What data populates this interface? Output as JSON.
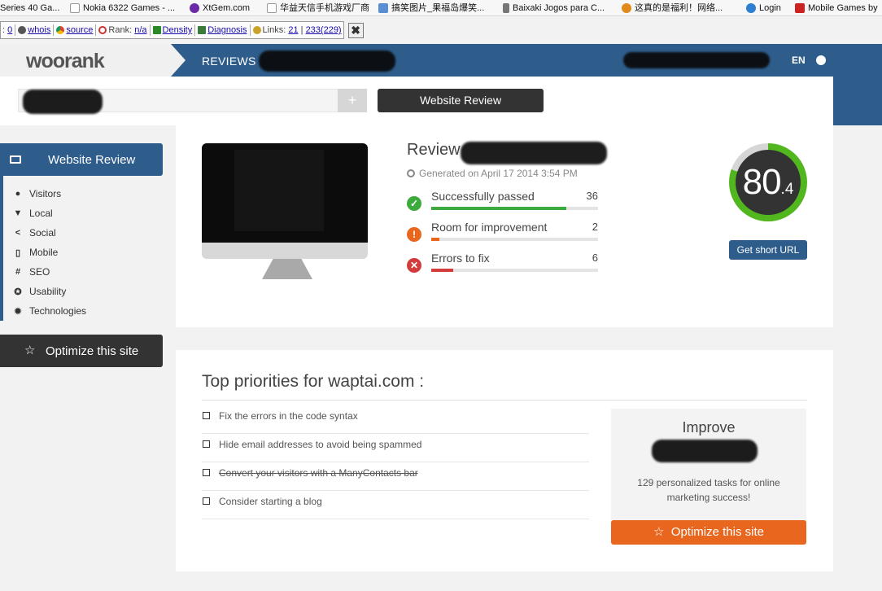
{
  "bookmarks": [
    {
      "label": "Series 40 Ga...",
      "color": "#d9a21b"
    },
    {
      "label": "Nokia 6322 Games - ...",
      "color": "#dddddd"
    },
    {
      "label": "XtGem.com",
      "color": "#6b2ba8"
    },
    {
      "label": "华益天信手机游戏厂商",
      "color": "#dddddd"
    },
    {
      "label": "搞笑图片_果福岛爆笑...",
      "color": "#5a8fd6"
    },
    {
      "label": "Baixaki Jogos para C...",
      "color": "#777777"
    },
    {
      "label": "这真的是福利！网络...",
      "color": "#e08a1e"
    },
    {
      "label": "Login",
      "color": "#2c7fd1"
    },
    {
      "label": "Mobile Games by",
      "color": "#cc2222"
    }
  ],
  "seo_toolbar": {
    "zero": "0",
    "whois": "whois",
    "source": "source",
    "rank_label": "Rank:",
    "rank_value": "n/a",
    "density": "Density",
    "diagnosis": "Diagnosis",
    "links_label": "Links:",
    "links_value": "21",
    "links_sep": "|",
    "links_total": "233(229)",
    "close": "✖"
  },
  "header": {
    "logo": "woorank",
    "section": "REVIEWS",
    "lang": "EN"
  },
  "search": {
    "add": "+",
    "button": "Website Review"
  },
  "sidebar": {
    "review_label": "Website Review",
    "items": [
      {
        "label": "Visitors",
        "icon": "user-icon",
        "glyph": "👤"
      },
      {
        "label": "Local",
        "icon": "map-pin-icon",
        "glyph": "⚲"
      },
      {
        "label": "Social",
        "icon": "share-icon",
        "glyph": "⋖"
      },
      {
        "label": "Mobile",
        "icon": "mobile-icon",
        "glyph": "▯"
      },
      {
        "label": "SEO",
        "icon": "hash-icon",
        "glyph": "#"
      },
      {
        "label": "Usability",
        "icon": "lifebuoy-icon",
        "glyph": "✪"
      },
      {
        "label": "Technologies",
        "icon": "gear-icon",
        "glyph": "✹"
      }
    ],
    "optimize_label": "Optimize this site"
  },
  "review": {
    "title": "Review",
    "generated": "Generated on April 17 2014 3:54 PM",
    "stats": [
      {
        "label": "Successfully passed",
        "count": "36",
        "fraction": 0.81,
        "color": "#3caa3c",
        "glyph": "✓"
      },
      {
        "label": "Room for improvement",
        "count": "2",
        "fraction": 0.05,
        "color": "#e8661e",
        "glyph": "!"
      },
      {
        "label": "Errors to fix",
        "count": "6",
        "fraction": 0.13,
        "color": "#d23c3c",
        "glyph": "✕"
      }
    ],
    "score_int": "80",
    "score_dec": ".4",
    "score_value": 80.4,
    "score_color": "#52b71e",
    "short_url": "Get short URL"
  },
  "priorities": {
    "title": "Top priorities for waptai.com :",
    "tasks": [
      {
        "text": "Fix the errors in the code syntax",
        "done": false
      },
      {
        "text": "Hide email addresses to avoid being spammed",
        "done": false
      },
      {
        "text": "Convert your visitors with a ManyContacts bar",
        "done": true
      },
      {
        "text": "Consider starting a blog",
        "done": false
      }
    ],
    "improve_heading": "Improve",
    "improve_text": "129 personalized tasks for online marketing success!",
    "optimize_button": "Optimize this site"
  }
}
